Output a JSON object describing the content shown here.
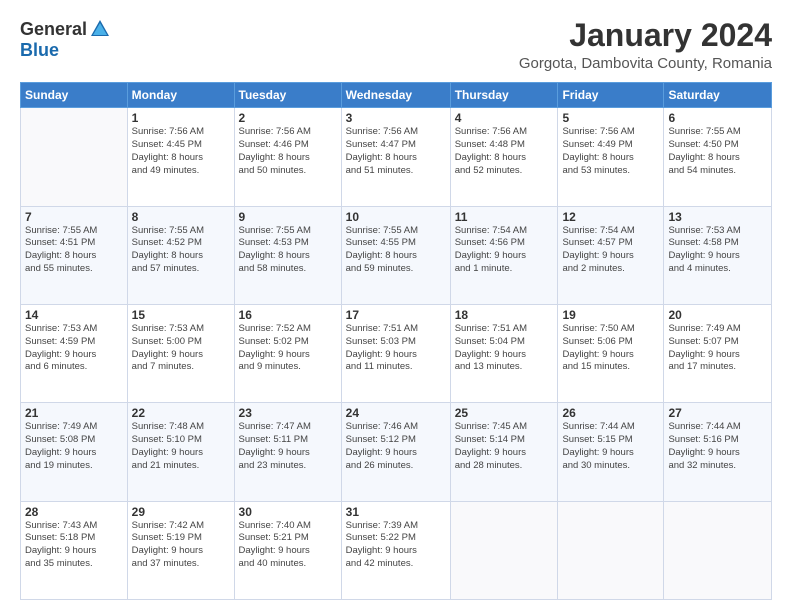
{
  "header": {
    "logo_general": "General",
    "logo_blue": "Blue",
    "month_title": "January 2024",
    "location": "Gorgota, Dambovita County, Romania"
  },
  "weekdays": [
    "Sunday",
    "Monday",
    "Tuesday",
    "Wednesday",
    "Thursday",
    "Friday",
    "Saturday"
  ],
  "weeks": [
    [
      {
        "day": "",
        "info": ""
      },
      {
        "day": "1",
        "info": "Sunrise: 7:56 AM\nSunset: 4:45 PM\nDaylight: 8 hours\nand 49 minutes."
      },
      {
        "day": "2",
        "info": "Sunrise: 7:56 AM\nSunset: 4:46 PM\nDaylight: 8 hours\nand 50 minutes."
      },
      {
        "day": "3",
        "info": "Sunrise: 7:56 AM\nSunset: 4:47 PM\nDaylight: 8 hours\nand 51 minutes."
      },
      {
        "day": "4",
        "info": "Sunrise: 7:56 AM\nSunset: 4:48 PM\nDaylight: 8 hours\nand 52 minutes."
      },
      {
        "day": "5",
        "info": "Sunrise: 7:56 AM\nSunset: 4:49 PM\nDaylight: 8 hours\nand 53 minutes."
      },
      {
        "day": "6",
        "info": "Sunrise: 7:55 AM\nSunset: 4:50 PM\nDaylight: 8 hours\nand 54 minutes."
      }
    ],
    [
      {
        "day": "7",
        "info": "Sunrise: 7:55 AM\nSunset: 4:51 PM\nDaylight: 8 hours\nand 55 minutes."
      },
      {
        "day": "8",
        "info": "Sunrise: 7:55 AM\nSunset: 4:52 PM\nDaylight: 8 hours\nand 57 minutes."
      },
      {
        "day": "9",
        "info": "Sunrise: 7:55 AM\nSunset: 4:53 PM\nDaylight: 8 hours\nand 58 minutes."
      },
      {
        "day": "10",
        "info": "Sunrise: 7:55 AM\nSunset: 4:55 PM\nDaylight: 8 hours\nand 59 minutes."
      },
      {
        "day": "11",
        "info": "Sunrise: 7:54 AM\nSunset: 4:56 PM\nDaylight: 9 hours\nand 1 minute."
      },
      {
        "day": "12",
        "info": "Sunrise: 7:54 AM\nSunset: 4:57 PM\nDaylight: 9 hours\nand 2 minutes."
      },
      {
        "day": "13",
        "info": "Sunrise: 7:53 AM\nSunset: 4:58 PM\nDaylight: 9 hours\nand 4 minutes."
      }
    ],
    [
      {
        "day": "14",
        "info": "Sunrise: 7:53 AM\nSunset: 4:59 PM\nDaylight: 9 hours\nand 6 minutes."
      },
      {
        "day": "15",
        "info": "Sunrise: 7:53 AM\nSunset: 5:00 PM\nDaylight: 9 hours\nand 7 minutes."
      },
      {
        "day": "16",
        "info": "Sunrise: 7:52 AM\nSunset: 5:02 PM\nDaylight: 9 hours\nand 9 minutes."
      },
      {
        "day": "17",
        "info": "Sunrise: 7:51 AM\nSunset: 5:03 PM\nDaylight: 9 hours\nand 11 minutes."
      },
      {
        "day": "18",
        "info": "Sunrise: 7:51 AM\nSunset: 5:04 PM\nDaylight: 9 hours\nand 13 minutes."
      },
      {
        "day": "19",
        "info": "Sunrise: 7:50 AM\nSunset: 5:06 PM\nDaylight: 9 hours\nand 15 minutes."
      },
      {
        "day": "20",
        "info": "Sunrise: 7:49 AM\nSunset: 5:07 PM\nDaylight: 9 hours\nand 17 minutes."
      }
    ],
    [
      {
        "day": "21",
        "info": "Sunrise: 7:49 AM\nSunset: 5:08 PM\nDaylight: 9 hours\nand 19 minutes."
      },
      {
        "day": "22",
        "info": "Sunrise: 7:48 AM\nSunset: 5:10 PM\nDaylight: 9 hours\nand 21 minutes."
      },
      {
        "day": "23",
        "info": "Sunrise: 7:47 AM\nSunset: 5:11 PM\nDaylight: 9 hours\nand 23 minutes."
      },
      {
        "day": "24",
        "info": "Sunrise: 7:46 AM\nSunset: 5:12 PM\nDaylight: 9 hours\nand 26 minutes."
      },
      {
        "day": "25",
        "info": "Sunrise: 7:45 AM\nSunset: 5:14 PM\nDaylight: 9 hours\nand 28 minutes."
      },
      {
        "day": "26",
        "info": "Sunrise: 7:44 AM\nSunset: 5:15 PM\nDaylight: 9 hours\nand 30 minutes."
      },
      {
        "day": "27",
        "info": "Sunrise: 7:44 AM\nSunset: 5:16 PM\nDaylight: 9 hours\nand 32 minutes."
      }
    ],
    [
      {
        "day": "28",
        "info": "Sunrise: 7:43 AM\nSunset: 5:18 PM\nDaylight: 9 hours\nand 35 minutes."
      },
      {
        "day": "29",
        "info": "Sunrise: 7:42 AM\nSunset: 5:19 PM\nDaylight: 9 hours\nand 37 minutes."
      },
      {
        "day": "30",
        "info": "Sunrise: 7:40 AM\nSunset: 5:21 PM\nDaylight: 9 hours\nand 40 minutes."
      },
      {
        "day": "31",
        "info": "Sunrise: 7:39 AM\nSunset: 5:22 PM\nDaylight: 9 hours\nand 42 minutes."
      },
      {
        "day": "",
        "info": ""
      },
      {
        "day": "",
        "info": ""
      },
      {
        "day": "",
        "info": ""
      }
    ]
  ]
}
